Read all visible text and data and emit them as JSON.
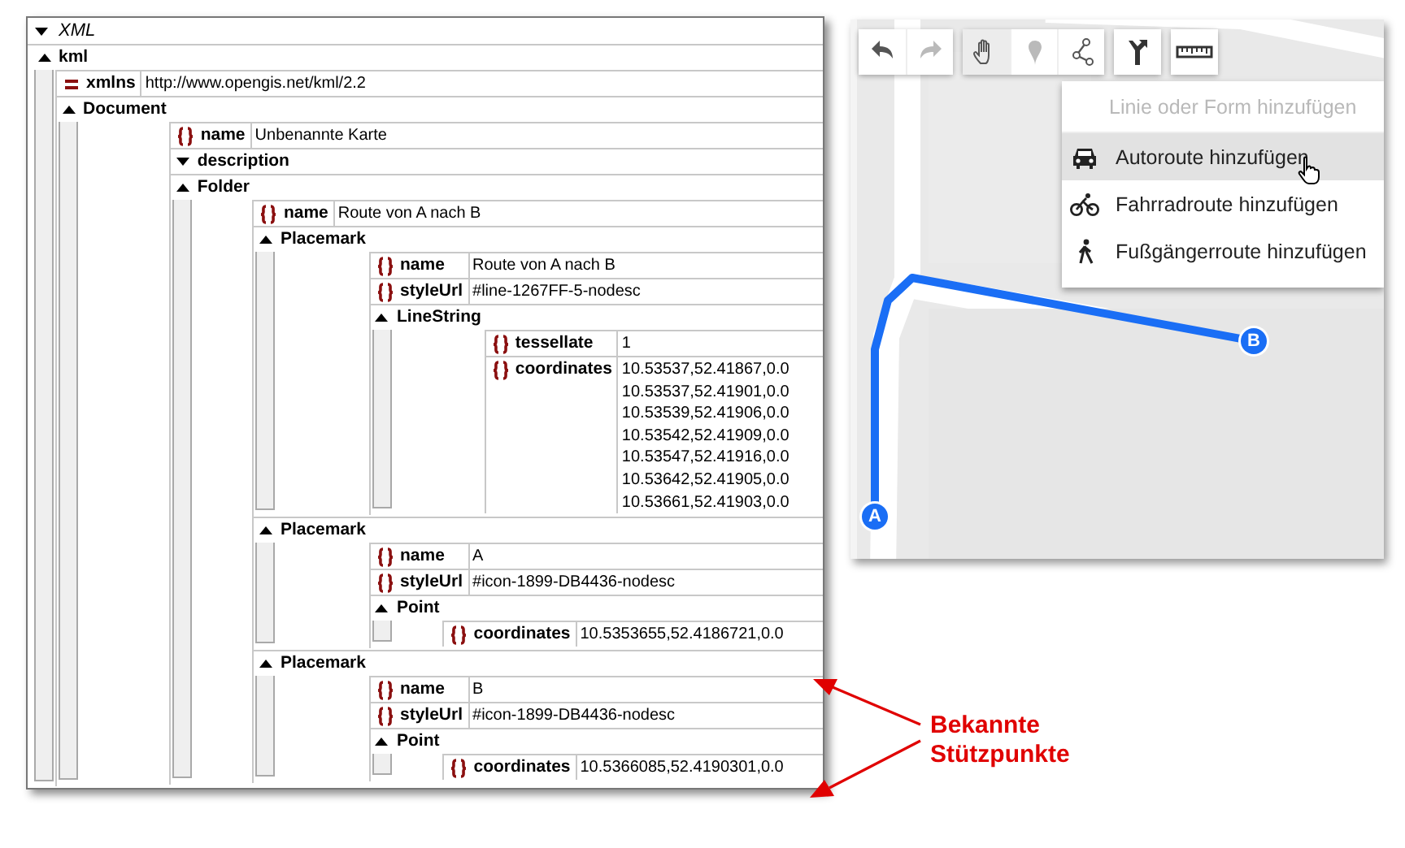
{
  "xml_grid": {
    "title": "XML",
    "root": {
      "kind": "element",
      "name": "kml",
      "expanded": true,
      "children": [
        {
          "kind": "attribute",
          "name": "xmlns",
          "value": "http://www.opengis.net/kml/2.2"
        },
        {
          "kind": "element",
          "name": "Document",
          "expanded": true,
          "children": [
            {
              "kind": "text",
              "name": "name",
              "value": "Unbenannte Karte"
            },
            {
              "kind": "element",
              "name": "description",
              "expanded": false
            },
            {
              "kind": "element",
              "name": "Folder",
              "expanded": true,
              "children": [
                {
                  "kind": "text",
                  "name": "name",
                  "value": "Route von A nach B"
                },
                {
                  "kind": "element",
                  "name": "Placemark",
                  "expanded": true,
                  "children": [
                    {
                      "kind": "text",
                      "name": "name",
                      "value": "Route von A nach B"
                    },
                    {
                      "kind": "text",
                      "name": "styleUrl",
                      "value": "#line-1267FF-5-nodesc"
                    },
                    {
                      "kind": "element",
                      "name": "LineString",
                      "expanded": true,
                      "children": [
                        {
                          "kind": "text",
                          "name": "tessellate",
                          "value": "1"
                        },
                        {
                          "kind": "text",
                          "name": "coordinates",
                          "value": "10.53537,52.41867,0.0\n10.53537,52.41901,0.0\n10.53539,52.41906,0.0\n10.53542,52.41909,0.0\n10.53547,52.41916,0.0\n10.53642,52.41905,0.0\n10.53661,52.41903,0.0"
                        }
                      ]
                    }
                  ]
                },
                {
                  "kind": "element",
                  "name": "Placemark",
                  "expanded": true,
                  "children": [
                    {
                      "kind": "text",
                      "name": "name",
                      "value": "A"
                    },
                    {
                      "kind": "text",
                      "name": "styleUrl",
                      "value": "#icon-1899-DB4436-nodesc"
                    },
                    {
                      "kind": "element",
                      "name": "Point",
                      "expanded": true,
                      "children": [
                        {
                          "kind": "text",
                          "name": "coordinates",
                          "value": "10.5353655,52.4186721,0.0"
                        }
                      ]
                    }
                  ]
                },
                {
                  "kind": "element",
                  "name": "Placemark",
                  "expanded": true,
                  "children": [
                    {
                      "kind": "text",
                      "name": "name",
                      "value": "B"
                    },
                    {
                      "kind": "text",
                      "name": "styleUrl",
                      "value": "#icon-1899-DB4436-nodesc"
                    },
                    {
                      "kind": "element",
                      "name": "Point",
                      "expanded": true,
                      "children": [
                        {
                          "kind": "text",
                          "name": "coordinates",
                          "value": "10.5366085,52.4190301,0.0"
                        }
                      ]
                    }
                  ]
                }
              ]
            }
          ]
        }
      ]
    }
  },
  "map": {
    "toolbar": [
      [
        {
          "kind": "undo",
          "disabled": false,
          "selected": false
        },
        {
          "kind": "redo",
          "disabled": true,
          "selected": false
        }
      ],
      [
        {
          "kind": "hand",
          "disabled": false,
          "selected": true
        },
        {
          "kind": "pin",
          "disabled": true,
          "selected": false
        },
        {
          "kind": "shape",
          "disabled": false,
          "selected": false
        }
      ],
      [
        {
          "kind": "route",
          "disabled": false,
          "selected": false
        }
      ],
      [
        {
          "kind": "ruler",
          "disabled": false,
          "selected": false
        }
      ]
    ],
    "menu": [
      {
        "kind": "header",
        "label": "Linie oder Form hinzufügen",
        "selected": false
      },
      {
        "kind": "car",
        "label": "Autoroute hinzufügen",
        "selected": true
      },
      {
        "kind": "bike",
        "label": "Fahrradroute hinzufügen",
        "selected": false
      },
      {
        "kind": "walk",
        "label": "Fußgängerroute hinzufügen",
        "selected": false
      }
    ],
    "markers": [
      {
        "label": "A"
      },
      {
        "label": "B"
      }
    ]
  },
  "annotation": {
    "text": "Bekannte Stützpunkte"
  }
}
